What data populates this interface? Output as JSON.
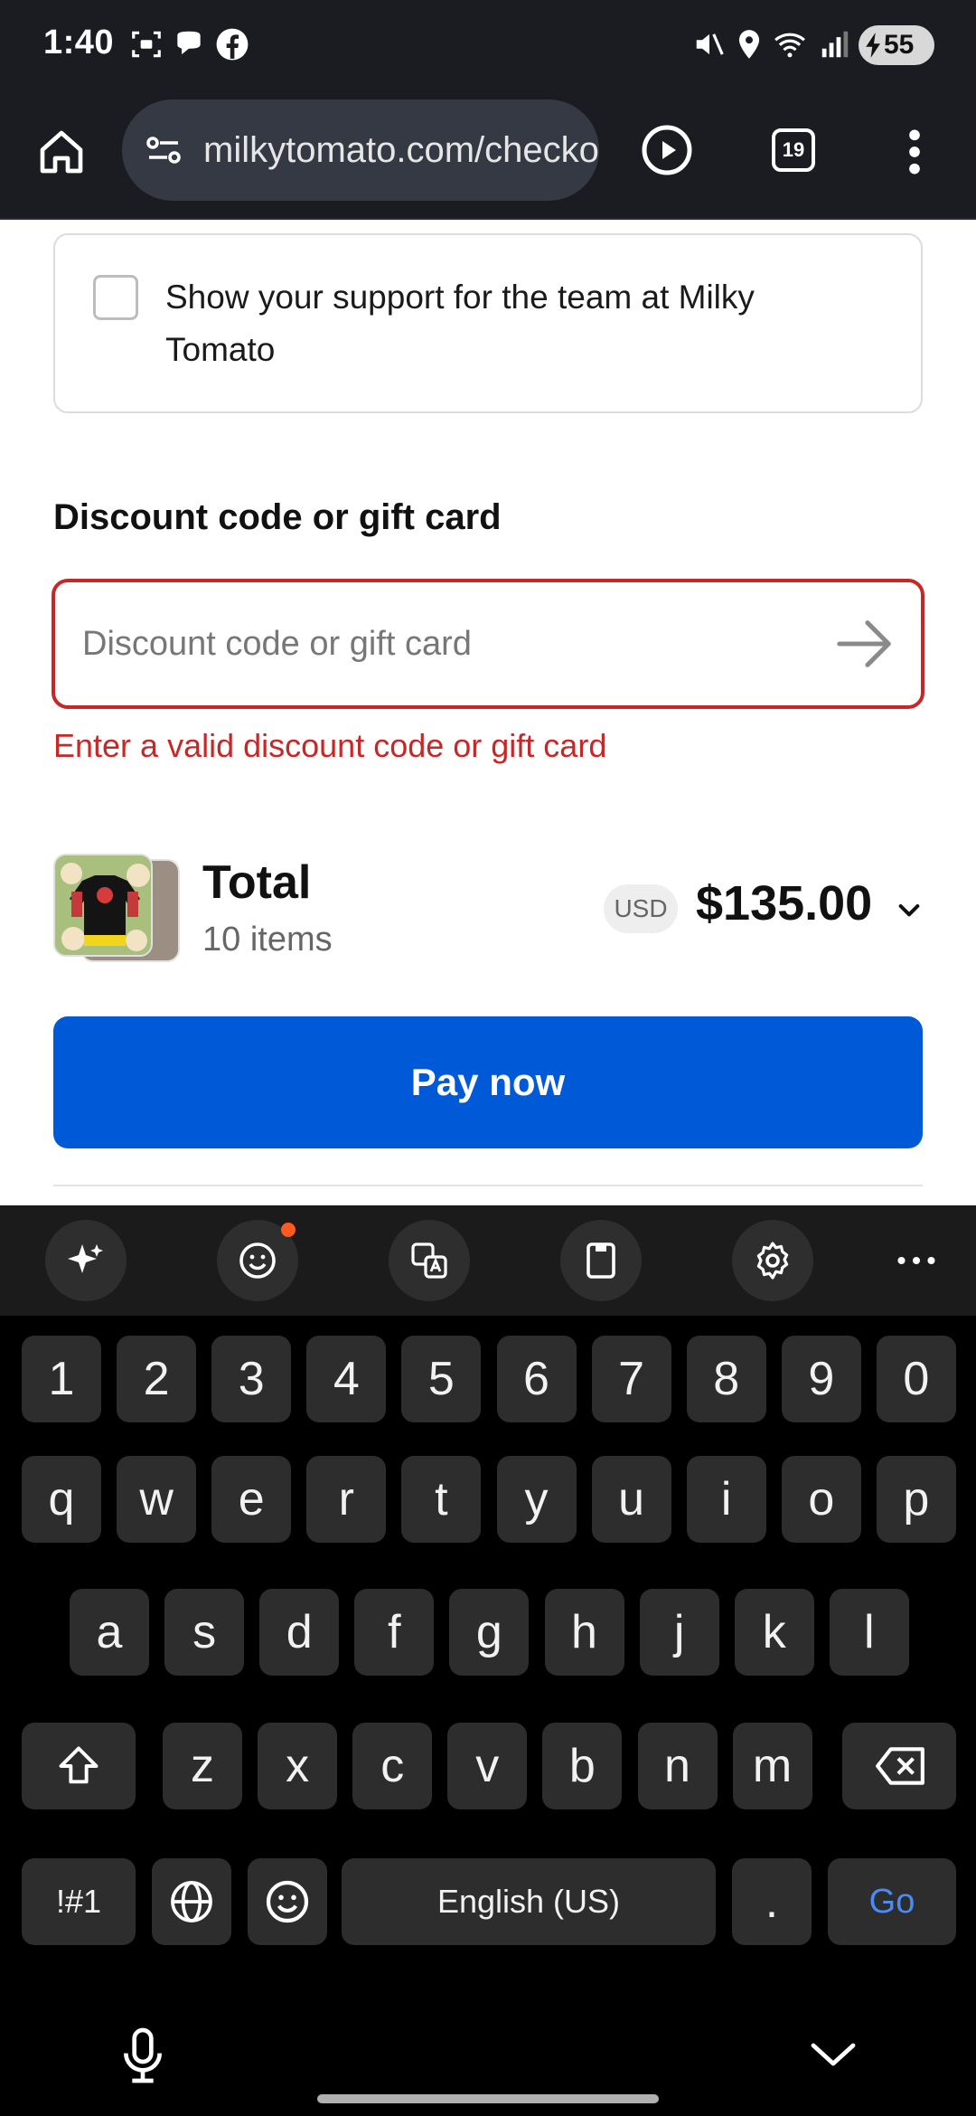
{
  "status_bar": {
    "time": "1:40",
    "battery": "55"
  },
  "browser": {
    "url": "milkytomato.com/checkouts",
    "tab_count": "19"
  },
  "support": {
    "text": "Show your support for the team at Milky Tomato"
  },
  "discount": {
    "title": "Discount code or gift card",
    "placeholder": "Discount code or gift card",
    "value": "",
    "error": "Enter a valid discount code or gift card"
  },
  "order": {
    "total_label": "Total",
    "items": "10 items",
    "currency": "USD",
    "amount": "$135.00"
  },
  "pay_button": "Pay now",
  "colors": {
    "accent": "#0059d6",
    "error": "#c62828"
  },
  "keyboard": {
    "row_numbers": [
      "1",
      "2",
      "3",
      "4",
      "5",
      "6",
      "7",
      "8",
      "9",
      "0"
    ],
    "row_top": [
      "q",
      "w",
      "e",
      "r",
      "t",
      "y",
      "u",
      "i",
      "o",
      "p"
    ],
    "row_mid": [
      "a",
      "s",
      "d",
      "f",
      "g",
      "h",
      "j",
      "k",
      "l"
    ],
    "row_bottom": [
      "z",
      "x",
      "c",
      "v",
      "b",
      "n",
      "m"
    ],
    "symbols": "!#1",
    "space": "English (US)",
    "period": ".",
    "go": "Go"
  }
}
